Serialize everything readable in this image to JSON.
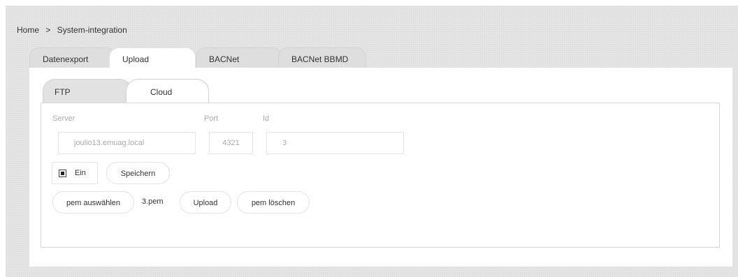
{
  "breadcrumb": {
    "home": "Home",
    "separator": ">",
    "current": "System-integration"
  },
  "main_tabs": [
    {
      "label": "Datenexport",
      "active": false
    },
    {
      "label": "Upload",
      "active": true
    },
    {
      "label": "BACNet",
      "active": false
    },
    {
      "label": "BACNet BBMD",
      "active": false
    }
  ],
  "sub_tabs": [
    {
      "label": "FTP",
      "active": false
    },
    {
      "label": "Cloud",
      "active": true
    }
  ],
  "form": {
    "server_label": "Server",
    "port_label": "Port",
    "id_label": "Id",
    "server_value": "joulio13.emuag.local",
    "port_value": "4321",
    "id_value": "3",
    "enabled_checked": true,
    "enabled_label": "Ein",
    "save_label": "Speichern",
    "select_pem_label": "pem auswählen",
    "pem_filename": "3.pem",
    "upload_label": "Upload",
    "delete_pem_label": "pem löschen"
  }
}
